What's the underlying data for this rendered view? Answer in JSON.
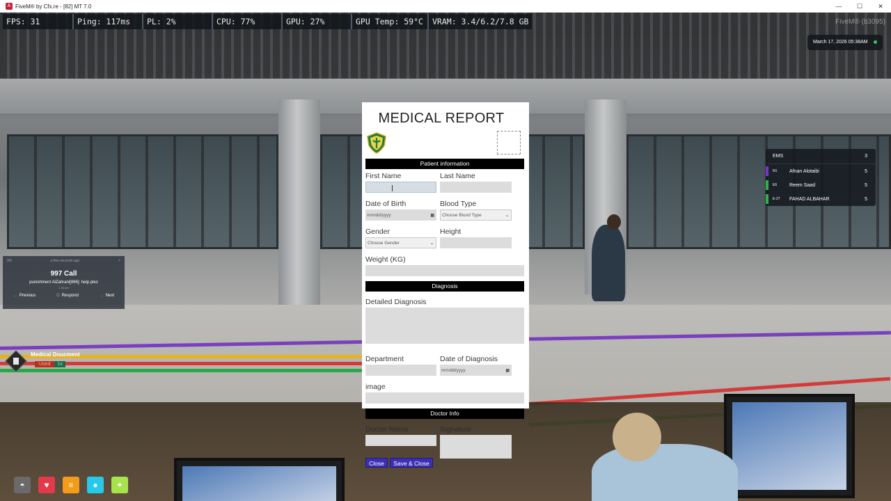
{
  "window": {
    "title": "FiveM® by Cfx.re - [82] MT 7.0",
    "icon_letter": "A",
    "controls": [
      "—",
      "☐",
      "✕"
    ]
  },
  "perf": {
    "fps": "FPS: 31",
    "ping": "Ping: 117ms",
    "pl": "PL: 2%",
    "cpu": "CPU: 77%",
    "gpu": "GPU: 27%",
    "gpu_temp": "GPU Temp: 59°C",
    "vram": "VRAM: 3.4/6.2/7.8 GB"
  },
  "version": "FiveM® (b3095)",
  "clock": "March 17, 2026 05:38AM",
  "ems": {
    "title": "EMS",
    "count": "3",
    "members": [
      {
        "code": "N1",
        "name": "Afnan Alotaibi",
        "value": "5",
        "color": "#7b2fd6"
      },
      {
        "code": "E6",
        "name": "Reem Saad",
        "value": "5",
        "color": "#2bb34a"
      },
      {
        "code": "E-27",
        "name": "FAHAD ALBAHAR",
        "value": "5",
        "color": "#2bb34a"
      }
    ]
  },
  "call": {
    "index": "9/9",
    "time": "a few seconds ago",
    "close": "×",
    "title": "997 Call",
    "subtitle": "punishment AlZahrani[896]: help plez",
    "distance": "1.32 km",
    "prev": "Previous",
    "prev_key": "←",
    "respond": "Respond",
    "respond_key": "G",
    "next": "Next",
    "next_key": "→"
  },
  "notification": {
    "title": "Medical Doucment",
    "used": "Used",
    "qty": "1x"
  },
  "status_icons": [
    {
      "name": "toilet-icon",
      "glyph": "◓",
      "color": "#6a6a6a"
    },
    {
      "name": "heart-icon",
      "glyph": "♥",
      "color": "#e23a4a"
    },
    {
      "name": "food-icon",
      "glyph": "≡",
      "color": "#f49b1a"
    },
    {
      "name": "water-icon",
      "glyph": "●",
      "color": "#27c9ea"
    },
    {
      "name": "stamina-icon",
      "glyph": "✦",
      "color": "#a7e34a"
    }
  ],
  "report": {
    "title": "MEDICAL REPORT",
    "section_patient": "Patient information",
    "first_name_label": "First Name",
    "last_name_label": "Last Name",
    "dob_label": "Date of Birth",
    "dob_placeholder": "mm/dd/yyyy",
    "blood_label": "Blood Type",
    "blood_value": "Choose Blood Type",
    "gender_label": "Gender",
    "gender_value": "Choose Gender",
    "height_label": "Height",
    "weight_label": "Weight (KG)",
    "section_diagnosis": "Diagnosis",
    "detailed_label": "Detailed Diagnosis",
    "department_label": "Department",
    "date_diag_label": "Date of Diagnosis",
    "date_diag_placeholder": "mm/dd/yyyy",
    "image_label": "image",
    "section_doctor": "Doctor Info",
    "doctor_name_label": "Doctor Name",
    "signature_label": "Signature",
    "close_button": "Close",
    "save_button": "Save & Close"
  }
}
